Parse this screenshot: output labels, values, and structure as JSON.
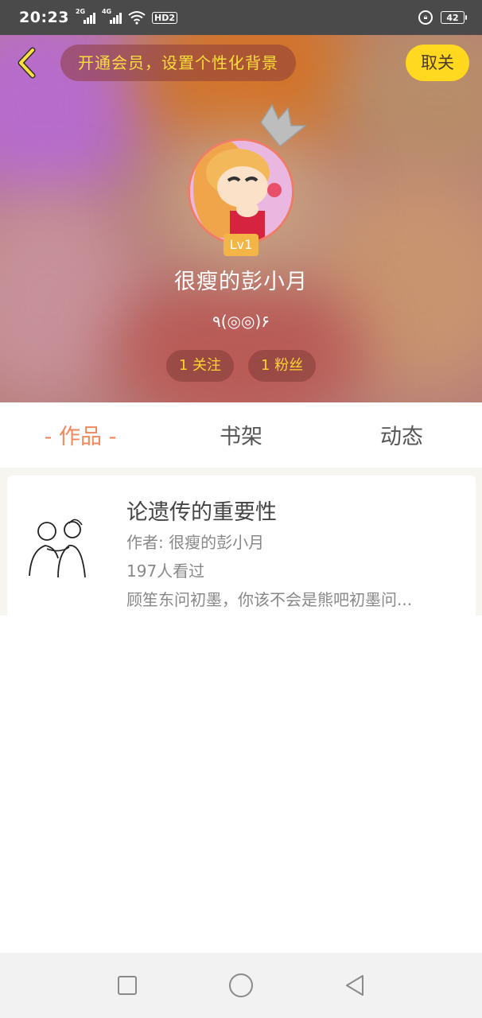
{
  "status_bar": {
    "time": "20:23",
    "signal_1_label": "2G",
    "signal_2_label": "4G",
    "hd_label": "HD2",
    "battery": "42"
  },
  "header": {
    "vip_banner": "开通会员，设置个性化背景",
    "unfollow_label": "取关",
    "level": "Lv1",
    "username": "很瘦的彭小月",
    "signature": "٩(◎◎)۶",
    "following": "1 关注",
    "followers": "1 粉丝"
  },
  "tabs": [
    {
      "label": "- 作品 -",
      "active": true
    },
    {
      "label": "书架",
      "active": false
    },
    {
      "label": "动态",
      "active": false
    }
  ],
  "works": [
    {
      "title": "论遗传的重要性",
      "author": "作者: 很瘦的彭小月",
      "views": "197人看过",
      "excerpt": "顾笙东问初墨，你该不会是熊吧初墨问..."
    }
  ],
  "colors": {
    "accent": "#f2875a",
    "highlight": "#ffd81f",
    "level_badge": "#f3b546"
  },
  "icons": {
    "back": "chevron-left-icon",
    "crown": "crown-icon",
    "nav_recent": "square-icon",
    "nav_home": "circle-icon",
    "nav_back": "triangle-back-icon"
  }
}
